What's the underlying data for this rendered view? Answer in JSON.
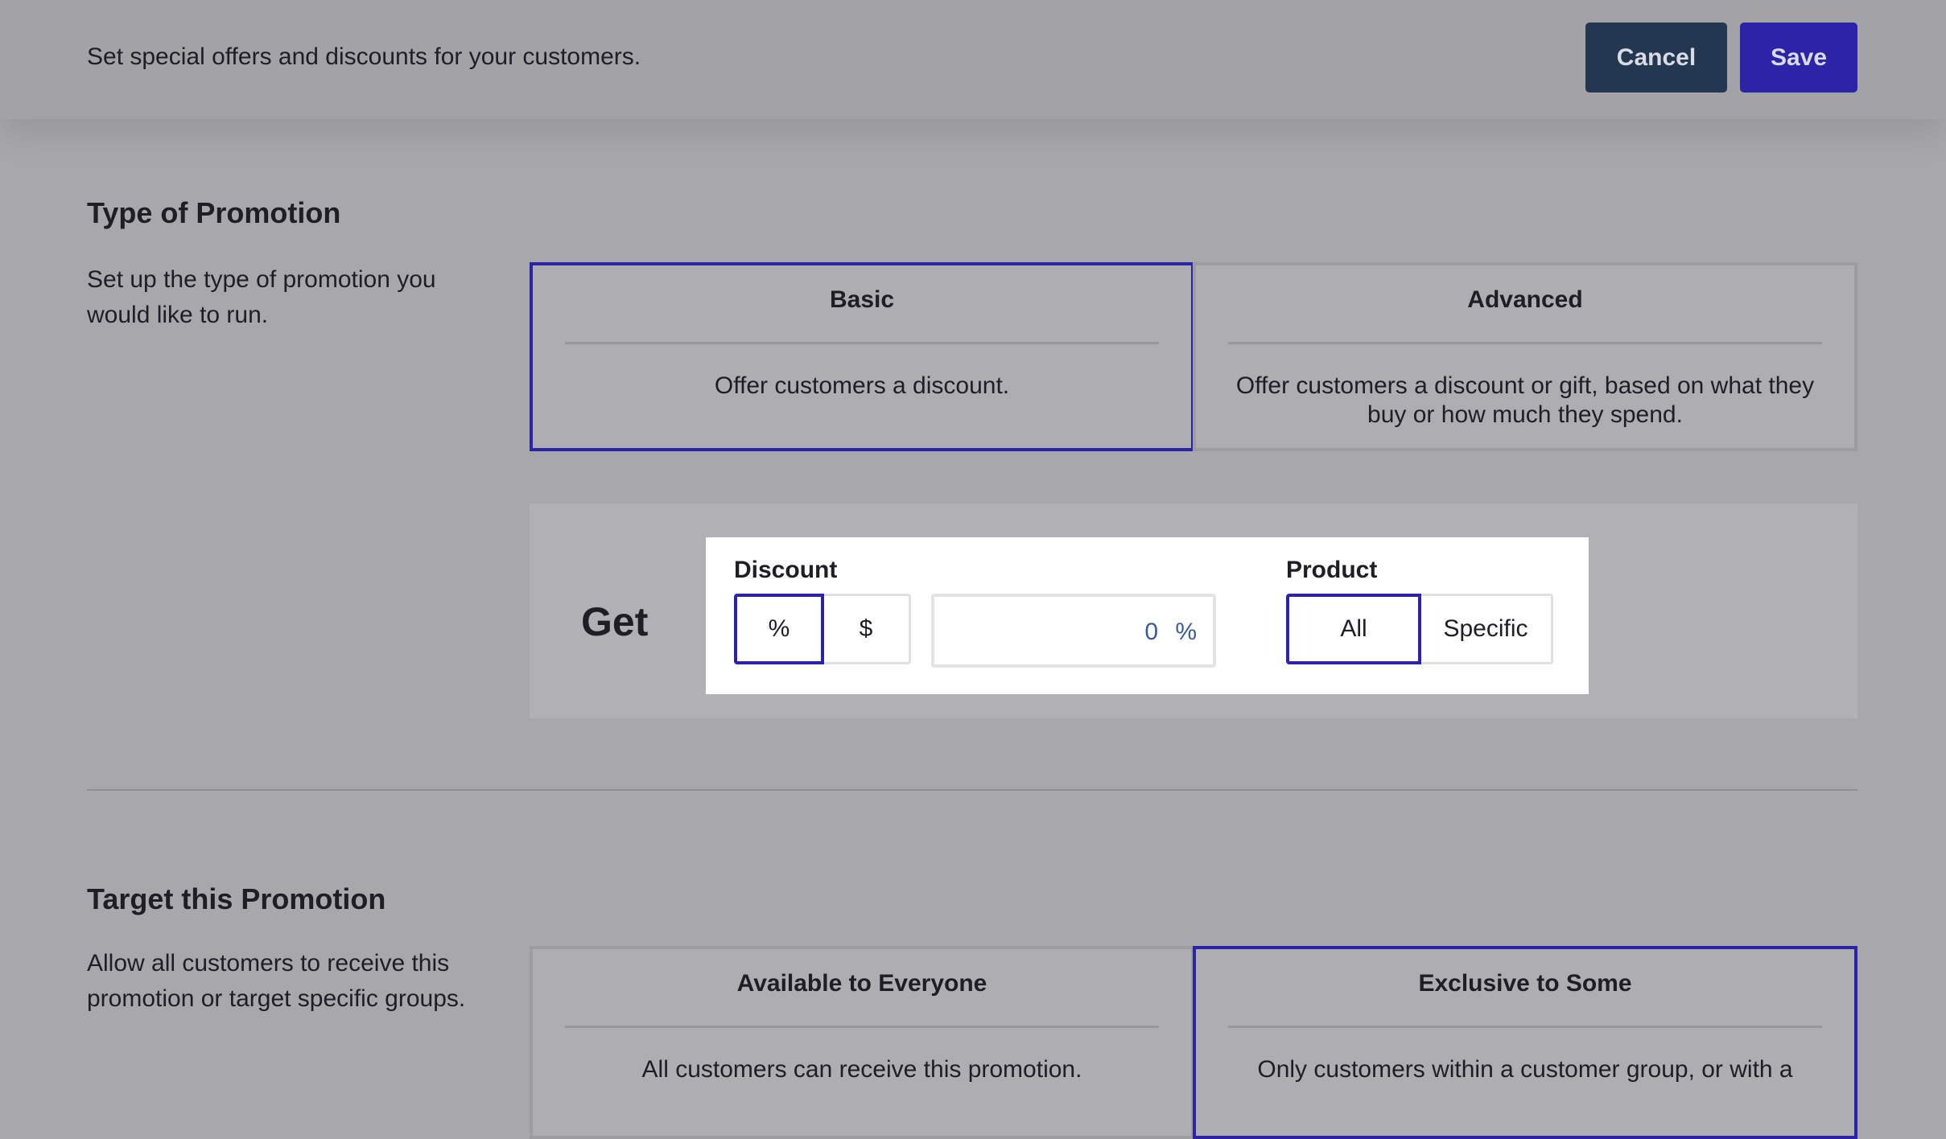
{
  "header": {
    "subtitle": "Set special offers and discounts for your customers.",
    "cancel_label": "Cancel",
    "save_label": "Save"
  },
  "promotion_type": {
    "title": "Type of Promotion",
    "description": "Set up the type of promotion you would like to run.",
    "options": [
      {
        "title": "Basic",
        "body": "Offer customers a discount.",
        "selected": true
      },
      {
        "title": "Advanced",
        "body": "Offer customers a discount or gift, based on what they buy or how much they spend.",
        "selected": false
      }
    ]
  },
  "get_panel": {
    "label": "Get",
    "discount": {
      "label": "Discount",
      "types": [
        "%",
        "$"
      ],
      "selected_type": "%",
      "value": "0",
      "unit": "%"
    },
    "product": {
      "label": "Product",
      "options": [
        "All",
        "Specific"
      ],
      "selected": "All"
    }
  },
  "target": {
    "title": "Target this Promotion",
    "description": "Allow all customers to receive this promotion or target specific groups.",
    "options": [
      {
        "title": "Available to Everyone",
        "body": "All customers can receive this promotion.",
        "selected": false
      },
      {
        "title": "Exclusive to Some",
        "body": "Only customers within a customer group, or with a",
        "selected": true
      }
    ]
  },
  "colors": {
    "accent": "#2c23a8",
    "cancel_bg": "#243750",
    "overlay_bg": "#a8a7ab"
  }
}
